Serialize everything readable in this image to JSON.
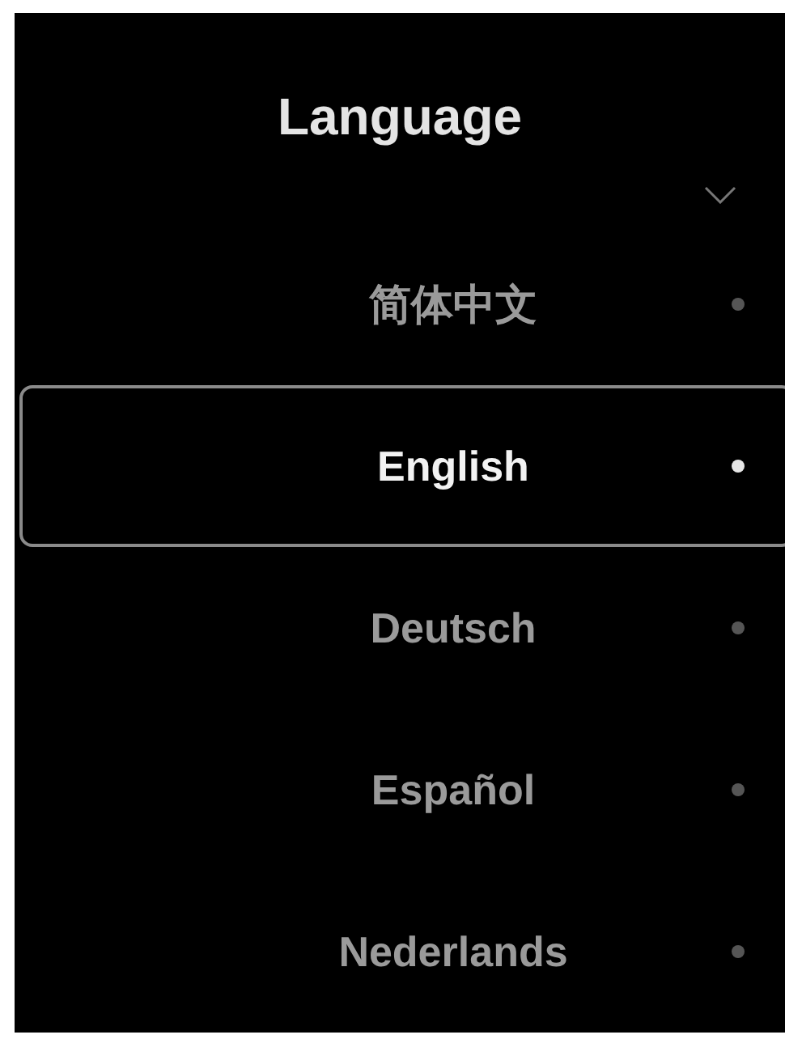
{
  "title": "Language",
  "languages": [
    {
      "label": "简体中文",
      "selected": false
    },
    {
      "label": "English",
      "selected": true
    },
    {
      "label": "Deutsch",
      "selected": false
    },
    {
      "label": "Español",
      "selected": false
    },
    {
      "label": "Nederlands",
      "selected": false
    }
  ]
}
